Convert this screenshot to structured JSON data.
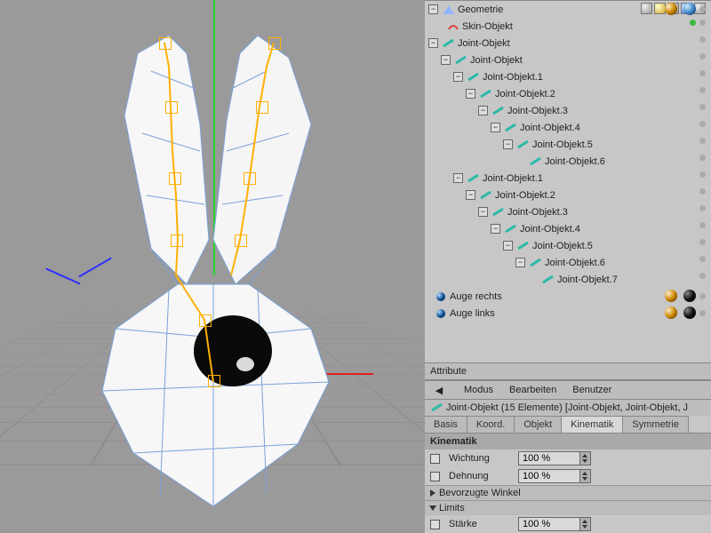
{
  "hierarchy": {
    "geom": "Geometrie",
    "skin": "Skin-Objekt",
    "root": "Joint-Objekt",
    "sub": "Joint-Objekt",
    "chainA": [
      "Joint-Objekt.1",
      "Joint-Objekt.2",
      "Joint-Objekt.3",
      "Joint-Objekt.4",
      "Joint-Objekt.5",
      "Joint-Objekt.6"
    ],
    "chainB": [
      "Joint-Objekt.1",
      "Joint-Objekt.2",
      "Joint-Objekt.3",
      "Joint-Objekt.4",
      "Joint-Objekt.5",
      "Joint-Objekt.6",
      "Joint-Objekt.7"
    ],
    "eyeR": "Auge rechts",
    "eyeL": "Auge links"
  },
  "attr": {
    "panel_label": "Attribute",
    "menu": {
      "mode": "Modus",
      "edit": "Bearbeiten",
      "user": "Benutzer"
    },
    "object_line": "Joint-Objekt (15 Elemente) [Joint-Objekt, Joint-Objekt, J",
    "tabs": {
      "basis": "Basis",
      "koord": "Koord.",
      "objekt": "Objekt",
      "kinematik": "Kinematik",
      "symmetrie": "Symmetrie"
    },
    "section": "Kinematik",
    "params": {
      "wichtung_label": "Wichtung",
      "wichtung_value": "100 %",
      "dehnung_label": "Dehnung",
      "dehnung_value": "100 %",
      "bevorzugte": "Bevorzugte Winkel",
      "limits": "Limits",
      "staerke_label": "Stärke",
      "staerke_value": "100 %"
    }
  }
}
